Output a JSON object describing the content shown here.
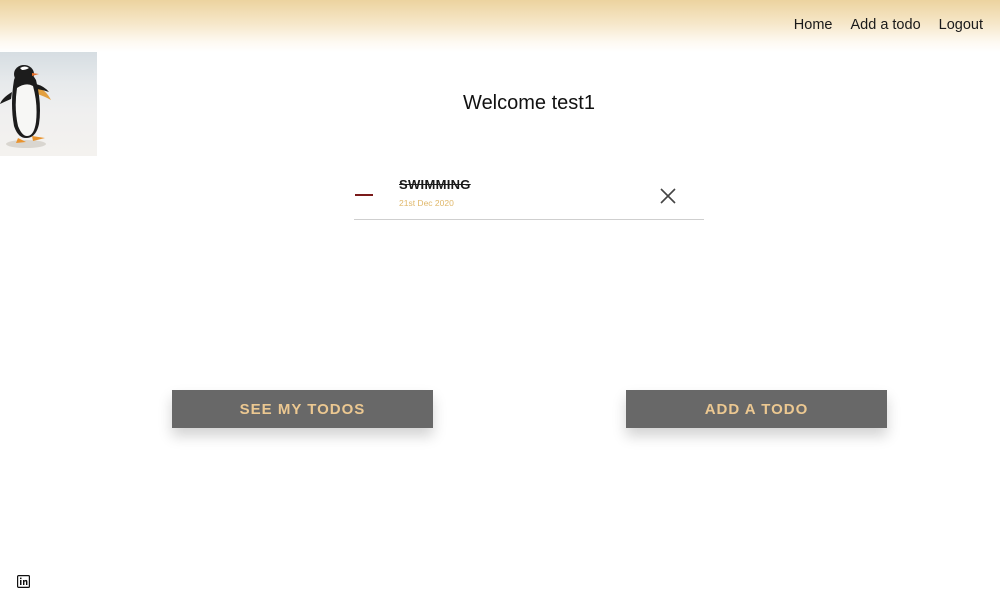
{
  "nav": {
    "home": "Home",
    "add_todo": "Add a todo",
    "logout": "Logout"
  },
  "image": {
    "icon": "penguin-photo"
  },
  "welcome": "Welcome test1",
  "todos": [
    {
      "title": "SWIMMING",
      "date": "21st Dec 2020",
      "completed": true,
      "delete_icon": "close-icon"
    }
  ],
  "buttons": {
    "see_todos": "SEE MY TODOS",
    "add_todo": "ADD A TODO"
  },
  "footer": {
    "icon": "linkedin-icon"
  },
  "colors": {
    "header_gradient_top": "#ecd39f",
    "button_bg": "#686868",
    "button_text": "#ecc891",
    "date_text": "#e0b86b",
    "dash": "#7a1a1a"
  }
}
